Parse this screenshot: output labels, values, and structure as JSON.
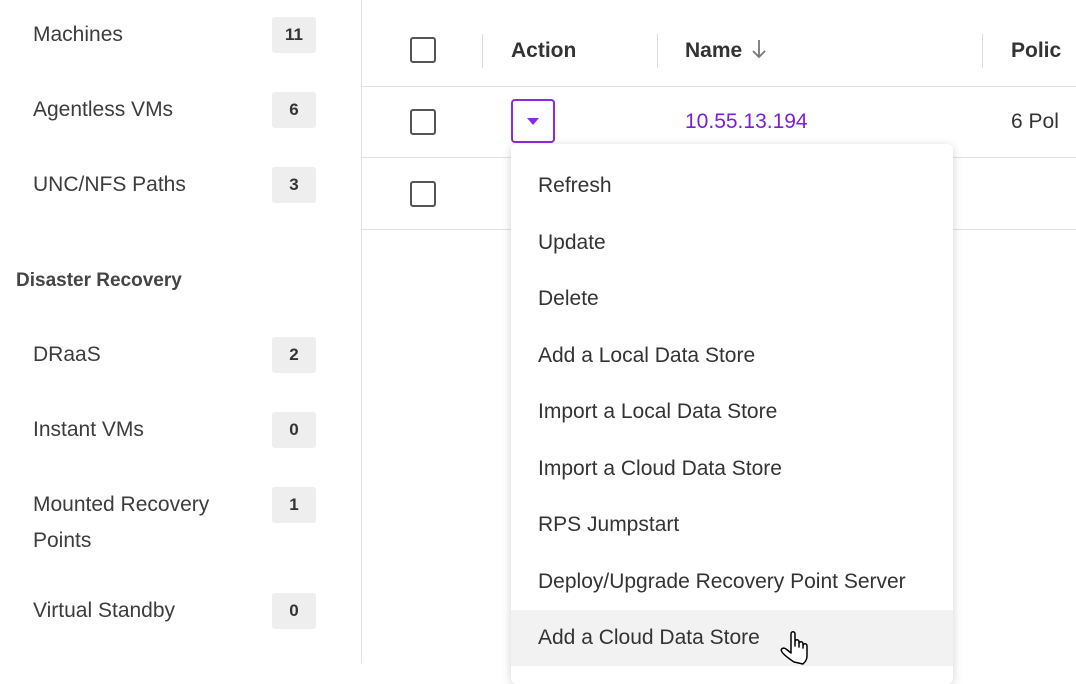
{
  "sidebar": {
    "items_top": [
      {
        "label": "Machines",
        "count": "11"
      },
      {
        "label": "Agentless VMs",
        "count": "6"
      },
      {
        "label": "UNC/NFS Paths",
        "count": "3"
      }
    ],
    "section_heading": "Disaster Recovery",
    "items_dr": [
      {
        "label": "DRaaS",
        "count": "2"
      },
      {
        "label": "Instant VMs",
        "count": "0"
      },
      {
        "label": "Mounted Recovery Points",
        "count": "1"
      },
      {
        "label": "Virtual Standby",
        "count": "0"
      }
    ]
  },
  "table": {
    "headers": {
      "action": "Action",
      "name": "Name",
      "policy": "Polic"
    },
    "rows": [
      {
        "name": "10.55.13.194",
        "policy": "6 Pol"
      }
    ]
  },
  "action_menu": {
    "items": [
      "Refresh",
      "Update",
      "Delete",
      "Add a Local Data Store",
      "Import a Local Data Store",
      "Import a Cloud Data Store",
      "RPS Jumpstart",
      "Deploy/Upgrade Recovery Point Server",
      "Add a Cloud Data Store"
    ],
    "hovered_index": 8
  },
  "colors": {
    "accent": "#7b1fd6",
    "badge_bg": "#eeeeee",
    "hover_bg": "#f2f2f2"
  }
}
